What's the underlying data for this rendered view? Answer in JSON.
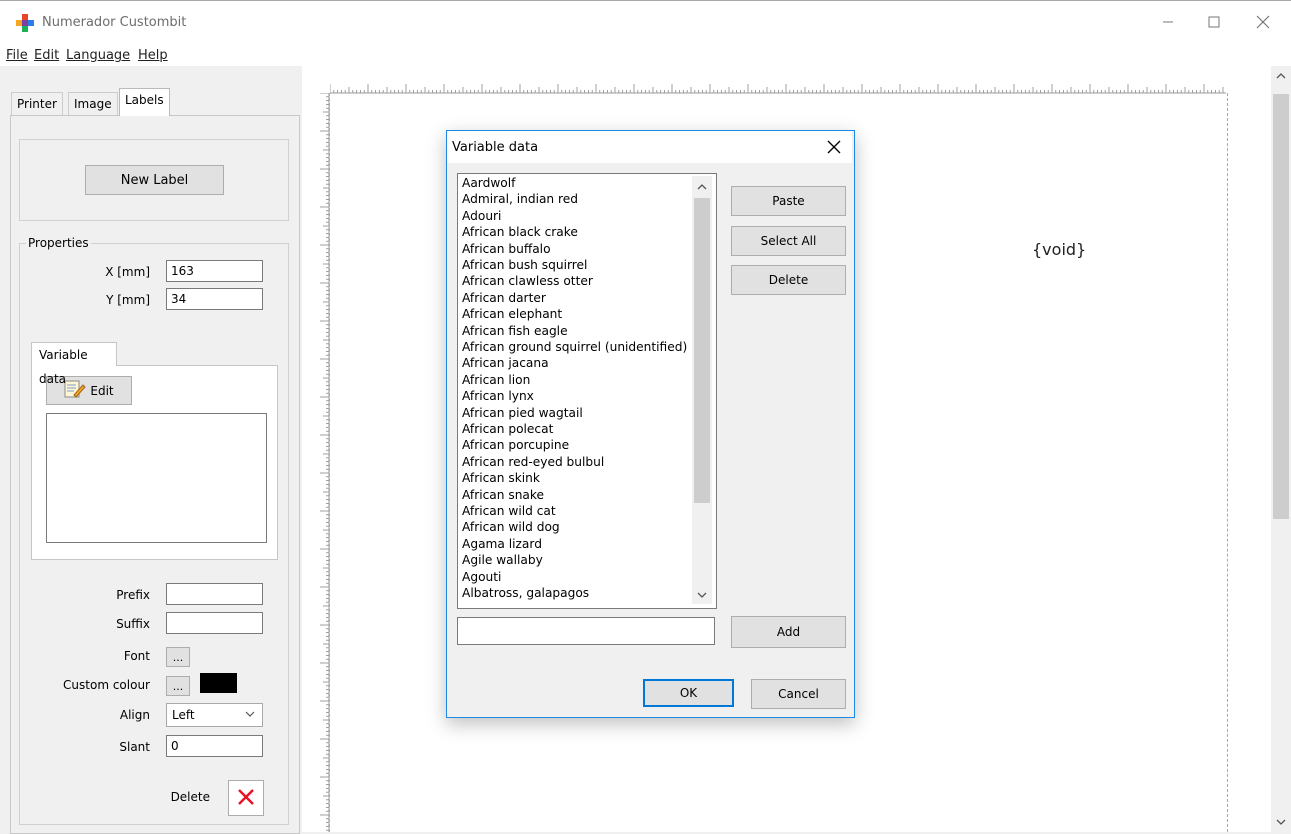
{
  "window": {
    "title": "Numerador Custombit",
    "controls": [
      "minimize-icon",
      "maximize-icon",
      "close-icon"
    ]
  },
  "menu": [
    {
      "label": "File"
    },
    {
      "label": "Edit"
    },
    {
      "label": "Language"
    },
    {
      "label": "Help"
    }
  ],
  "tabs": [
    {
      "label": "Printer"
    },
    {
      "label": "Image"
    },
    {
      "label": "Labels",
      "active": true
    }
  ],
  "left": {
    "new_label_button": "New Label",
    "properties_title": "Properties",
    "x_label": "X [mm]",
    "x_value": "163",
    "y_label": "Y [mm]",
    "y_value": "34",
    "variable_data_tab": "Variable data",
    "edit_button": "Edit",
    "prefix_label": "Prefix",
    "prefix_value": "",
    "suffix_label": "Suffix",
    "suffix_value": "",
    "font_label": "Font",
    "font_button": "...",
    "custom_colour_label": "Custom colour",
    "custom_colour_button": "...",
    "custom_colour_value": "#000000",
    "align_label": "Align",
    "align_value": "Left",
    "slant_label": "Slant",
    "slant_value": "0",
    "delete_label": "Delete"
  },
  "canvas": {
    "placeholder_text": "{void}"
  },
  "dialog": {
    "title": "Variable data",
    "items": [
      "Aardwolf",
      "Admiral, indian red",
      "Adouri",
      "African black crake",
      "African buffalo",
      "African bush squirrel",
      "African clawless otter",
      "African darter",
      "African elephant",
      "African fish eagle",
      "African ground squirrel (unidentified)",
      "African jacana",
      "African lion",
      "African lynx",
      "African pied wagtail",
      "African polecat",
      "African porcupine",
      "African red-eyed bulbul",
      "African skink",
      "African snake",
      "African wild cat",
      "African wild dog",
      "Agama lizard",
      "Agile wallaby",
      "Agouti",
      "Albatross, galapagos"
    ],
    "paste_button": "Paste",
    "select_all_button": "Select All",
    "delete_button": "Delete",
    "add_input_value": "",
    "add_button": "Add",
    "ok_button": "OK",
    "cancel_button": "Cancel"
  },
  "colors": {
    "accent": "#0078d7",
    "dialog_border": "#1e88e5",
    "delete_x": "#e81123"
  }
}
